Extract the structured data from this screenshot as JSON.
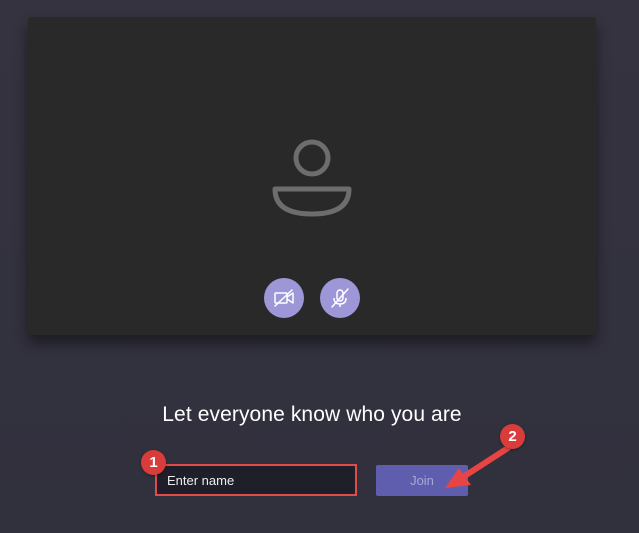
{
  "preview": {
    "avatar_icon": "person-avatar-icon",
    "camera_button": {
      "icon": "camera-off-icon",
      "color": "#9d97d8"
    },
    "mic_button": {
      "icon": "microphone-off-icon",
      "color": "#9d97d8"
    }
  },
  "join_form": {
    "prompt": "Let everyone know who you are",
    "name_placeholder": "Enter name",
    "name_value": "",
    "join_label": "Join"
  },
  "annotations": {
    "step_1": "1",
    "step_2": "2",
    "highlight_color": "#e04b4b",
    "arrow_color": "#e84444"
  },
  "colors": {
    "background": "#33323f",
    "card": "#292929",
    "join_button": "#5f5eae"
  }
}
